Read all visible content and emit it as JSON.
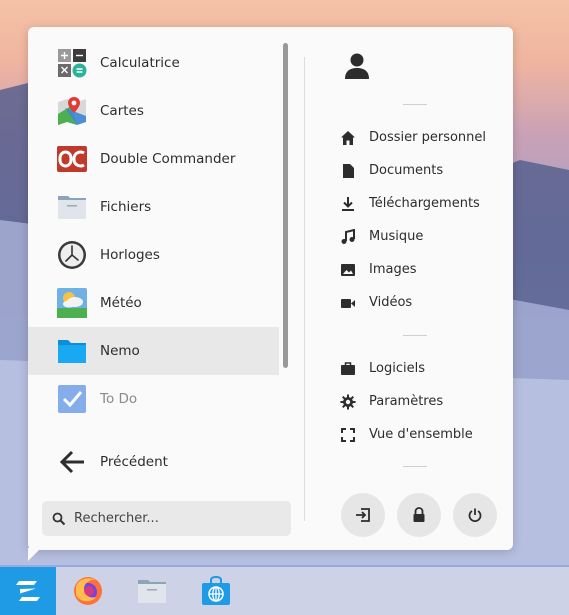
{
  "colors": {
    "accent": "#1e9be4",
    "menu_background": "#fafafa",
    "active_item": "#e8e8e8"
  },
  "apps": [
    {
      "label": "Calculatrice",
      "icon": "calculator-icon"
    },
    {
      "label": "Cartes",
      "icon": "maps-icon"
    },
    {
      "label": "Double Commander",
      "icon": "double-commander-icon"
    },
    {
      "label": "Fichiers",
      "icon": "files-icon"
    },
    {
      "label": "Horloges",
      "icon": "clocks-icon"
    },
    {
      "label": "Météo",
      "icon": "weather-icon"
    },
    {
      "label": "Nemo",
      "icon": "nemo-folder-icon",
      "active": true
    },
    {
      "label": "To Do",
      "icon": "todo-icon"
    }
  ],
  "back_label": "Précédent",
  "search": {
    "placeholder": "Rechercher..."
  },
  "places": [
    {
      "label": "Dossier personnel",
      "icon": "home-icon"
    },
    {
      "label": "Documents",
      "icon": "document-icon"
    },
    {
      "label": "Téléchargements",
      "icon": "download-icon"
    },
    {
      "label": "Musique",
      "icon": "music-icon"
    },
    {
      "label": "Images",
      "icon": "image-icon"
    },
    {
      "label": "Vidéos",
      "icon": "video-icon"
    }
  ],
  "system": [
    {
      "label": "Logiciels",
      "icon": "briefcase-icon"
    },
    {
      "label": "Paramètres",
      "icon": "gear-icon"
    },
    {
      "label": "Vue d'ensemble",
      "icon": "overview-icon"
    }
  ],
  "session_buttons": [
    "logout-icon",
    "lock-icon",
    "power-icon"
  ],
  "taskbar": [
    "zorin-logo-icon",
    "firefox-icon",
    "files-icon",
    "software-store-icon"
  ]
}
